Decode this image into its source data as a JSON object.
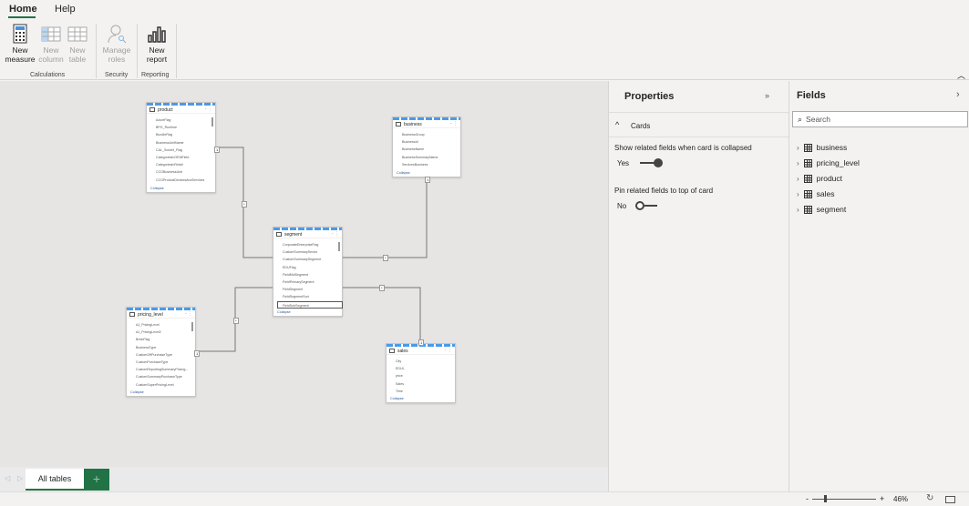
{
  "ribbon": {
    "tabs": [
      "Home",
      "Help"
    ],
    "buttons": [
      {
        "l1": "New",
        "l2": "measure"
      },
      {
        "l1": "New",
        "l2": "column"
      },
      {
        "l1": "New",
        "l2": "table"
      },
      {
        "l1": "Manage",
        "l2": "roles"
      },
      {
        "l1": "New",
        "l2": "report"
      }
    ],
    "groups": [
      "Calculations",
      "Security",
      "Reporting"
    ]
  },
  "tables": [
    {
      "name": "product",
      "fields": [
        "AzureFlag",
        "BPG_Runtime",
        "BundleFlag",
        "BusinessUnitName",
        "CAL_Socket_Flag",
        "CategoriesInOEMField",
        "CategoriesInRetail",
        "CCGBusinessUnit",
        "CCGProductDevicesAndServices"
      ]
    },
    {
      "name": "business",
      "fields": [
        "BusinessGroup",
        "BusinessId",
        "BusinessName",
        "BusinessSummaryName",
        "ServicesBusiness"
      ]
    },
    {
      "name": "segment",
      "fields": [
        "CorporateEnterpriseFlag",
        "CustomSummarySector",
        "CustomSummarySegment",
        "EDUFlag",
        "FieldMidSegment",
        "FieldPrimarySegment",
        "FieldSegment",
        "FieldSegmentSort",
        "FieldSubSegment"
      ]
    },
    {
      "name": "pricing_level",
      "fields": [
        "AJ_PricingLevel",
        "AJ_PricingLevel2",
        "BreinFlag",
        "BusinessType",
        "CustomOffPurchaseType",
        "CustomPurchaseType",
        "CustomReportingSummaryPricing...",
        "CustomSummaryPurchaseType",
        "CustomSuperPricingLevel"
      ]
    },
    {
      "name": "sales",
      "fields": [
        "City",
        "EDUL",
        "price",
        "Sales",
        "Time"
      ]
    }
  ],
  "card_collapse": "Collapse",
  "relationships": {
    "one": "1",
    "many": "*"
  },
  "page_tabs": {
    "active": "All tables",
    "add": "+"
  },
  "status": {
    "zoom": "46%",
    "minus": "-",
    "plus": "+"
  },
  "properties": {
    "title": "Properties",
    "section": "Cards",
    "opt1": "Show related fields when card is collapsed",
    "opt1_value": "Yes",
    "opt1_on": true,
    "opt2": "Pin related fields to top of card",
    "opt2_value": "No",
    "opt2_on": false
  },
  "fields": {
    "title": "Fields",
    "search_placeholder": "Search",
    "items": [
      "business",
      "pricing_level",
      "product",
      "sales",
      "segment"
    ]
  },
  "colors": {
    "accent": "#217346",
    "card_top": "#4a9be8"
  }
}
